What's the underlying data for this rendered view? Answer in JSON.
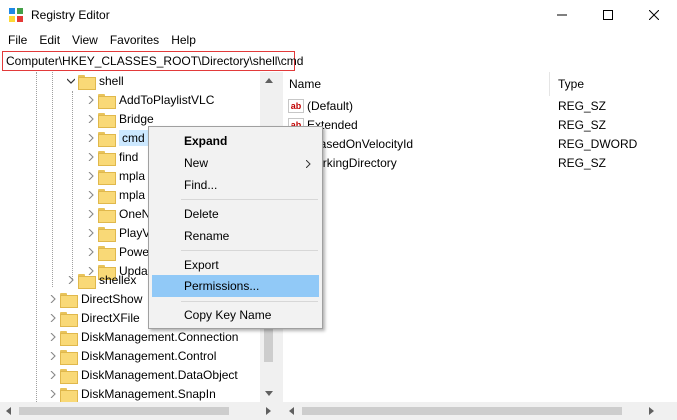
{
  "window": {
    "title": "Registry Editor",
    "minimize_label": "—",
    "maximize_label": "☐",
    "close_label": "✕"
  },
  "menu": [
    "File",
    "Edit",
    "View",
    "Favorites",
    "Help"
  ],
  "address": "Computer\\HKEY_CLASSES_ROOT\\Directory\\shell\\cmd",
  "tree": {
    "shell": "shell",
    "children": [
      "AddToPlaylistVLC",
      "Bridge",
      "cmd",
      "find",
      "mpla",
      "mpla",
      "OneN",
      "PlayV",
      "Powe",
      "Upda"
    ],
    "shellex": "shellex",
    "siblings": [
      "DirectShow",
      "DirectXFile",
      "DiskManagement.Connection",
      "DiskManagement.Control",
      "DiskManagement.DataObject",
      "DiskManagement.SnapIn"
    ]
  },
  "values": {
    "name_header": "Name",
    "type_header": "Type",
    "rows": [
      {
        "name": "(Default)",
        "type": "REG_SZ"
      },
      {
        "name": "Extended",
        "type": "REG_SZ"
      },
      {
        "name": "eBasedOnVelocityId",
        "type": "REG_DWORD"
      },
      {
        "name": "WorkingDirectory",
        "type": "REG_SZ"
      }
    ]
  },
  "context_menu": {
    "expand": "Expand",
    "new": "New",
    "find": "Find...",
    "delete": "Delete",
    "rename": "Rename",
    "export": "Export",
    "permissions": "Permissions...",
    "copy_key_name": "Copy Key Name"
  },
  "colors": {
    "selection": "#cce8ff",
    "menu_highlight": "#91c9f7",
    "address_border": "#e23a3a"
  }
}
